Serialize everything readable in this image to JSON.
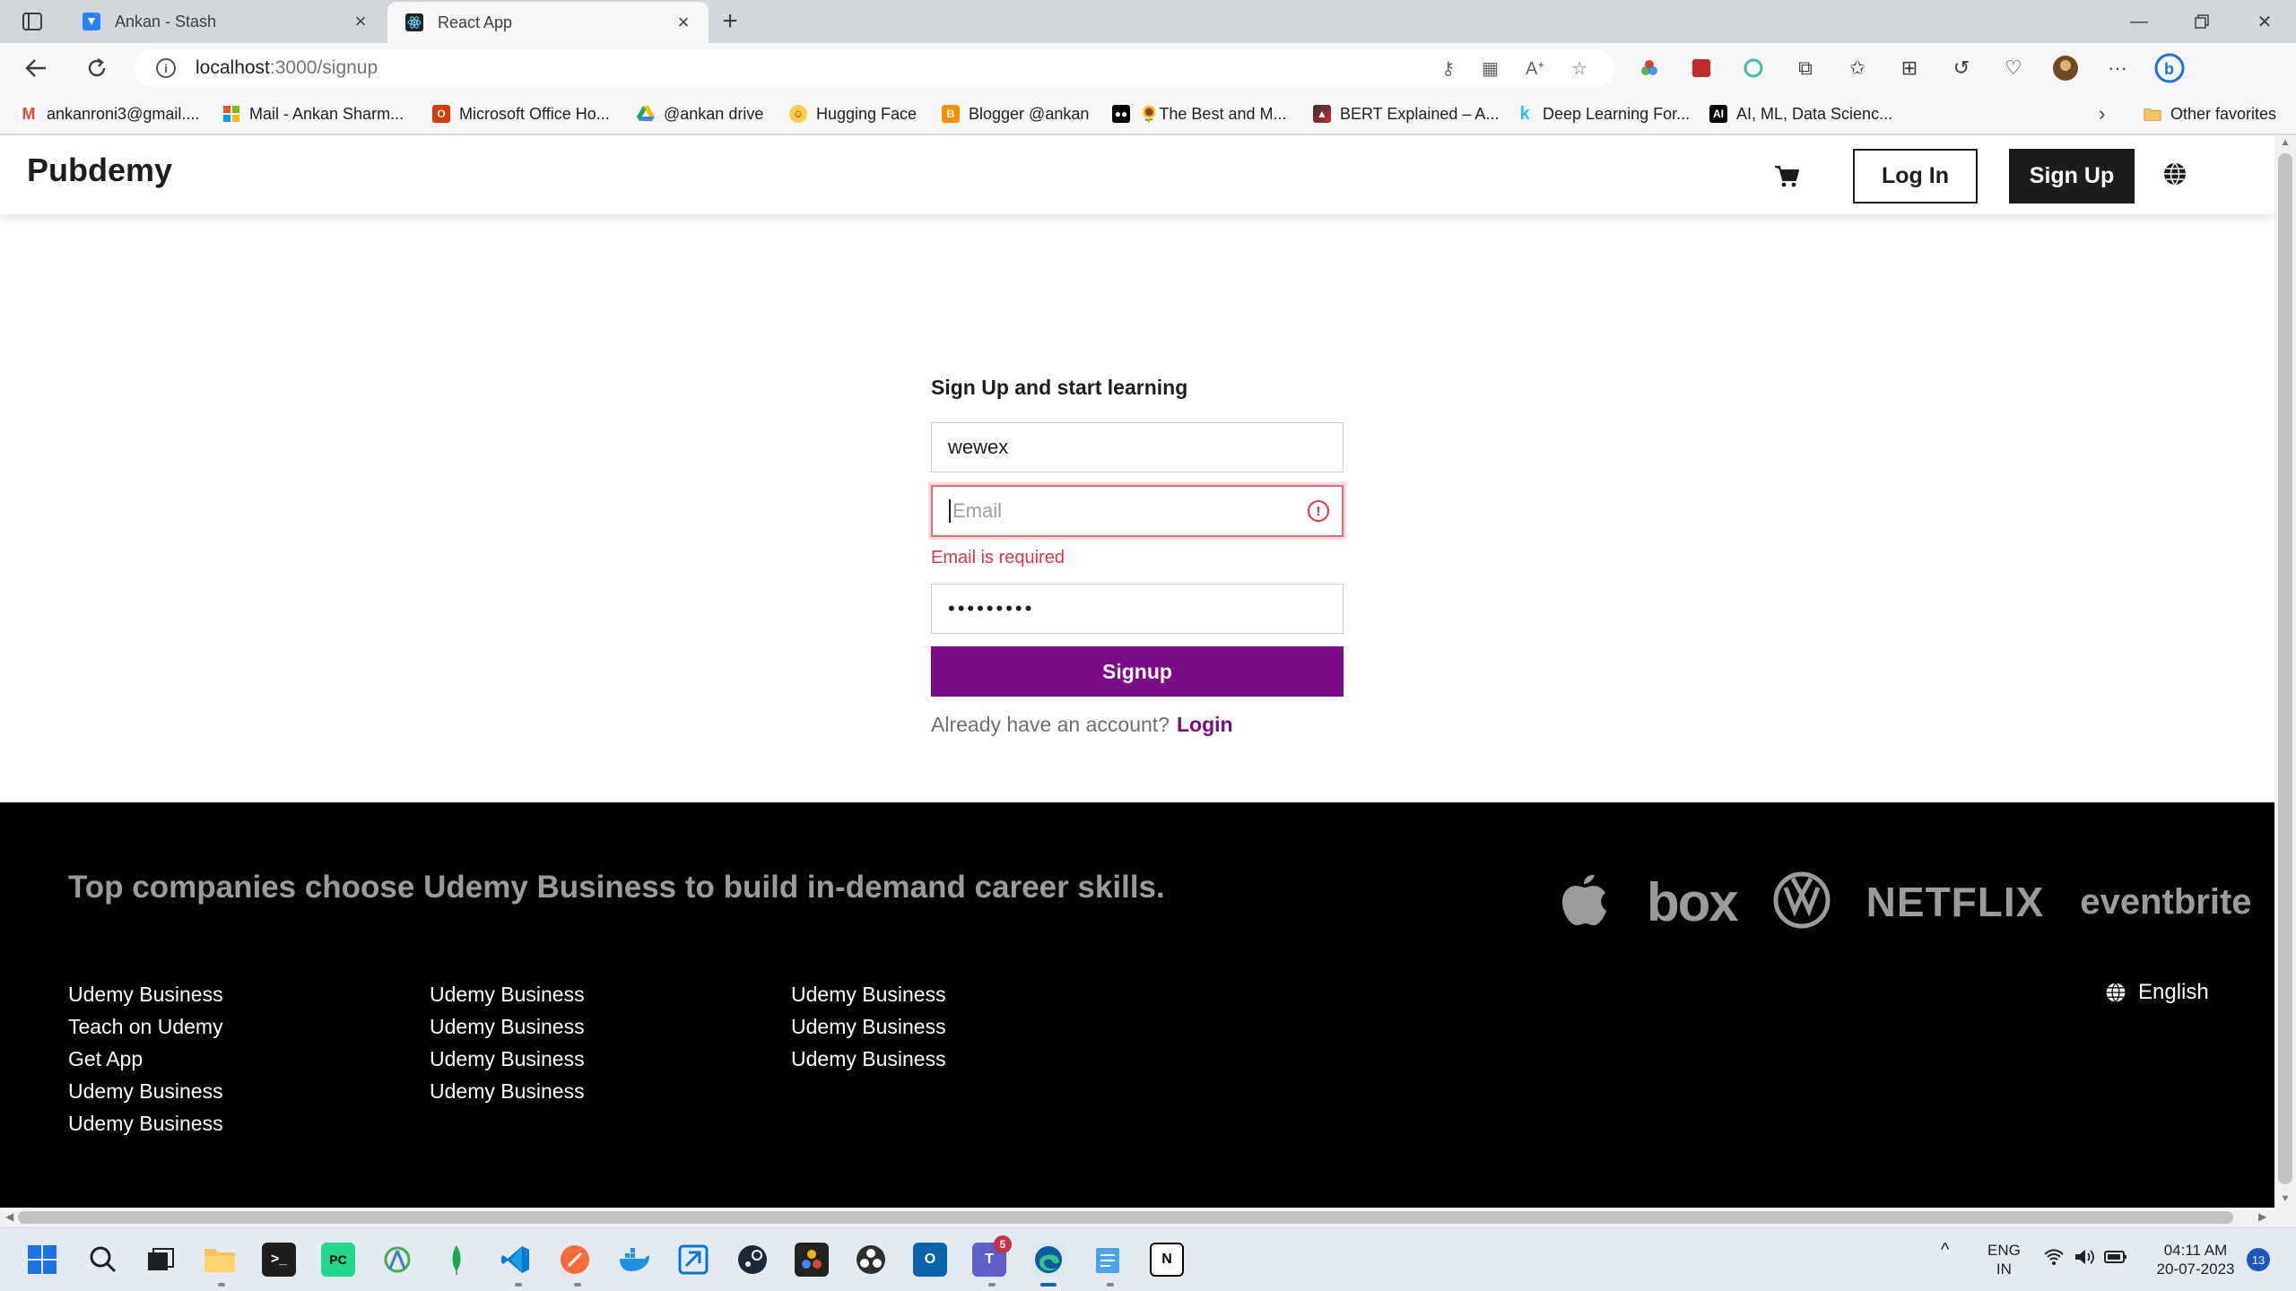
{
  "browser": {
    "tabs": [
      {
        "title": "Ankan - Stash",
        "active": false,
        "icon": "stash-icon"
      },
      {
        "title": "React App",
        "active": true,
        "icon": "react-icon"
      }
    ],
    "url": {
      "host": "localhost",
      "path": ":3000/signup"
    },
    "bookmarks": [
      {
        "label": "ankanroni3@gmail....",
        "icon": "gmail-icon",
        "color": "#ea4335"
      },
      {
        "label": "Mail - Ankan Sharm...",
        "icon": "microsoft-icon",
        "color": "#0078d4"
      },
      {
        "label": "Microsoft Office Ho...",
        "icon": "office-icon",
        "color": "#d83b01"
      },
      {
        "label": "@ankan drive",
        "icon": "drive-icon",
        "color": "#1fa463"
      },
      {
        "label": "Hugging Face",
        "icon": "hugging-face-icon",
        "color": "#ffcc4d"
      },
      {
        "label": "Blogger @ankan",
        "icon": "blogger-icon",
        "color": "#ff8f00"
      },
      {
        "label": "🌻The Best and M...",
        "icon": "medium-icon",
        "color": "#000000"
      },
      {
        "label": "BERT Explained – A...",
        "icon": "bert-icon",
        "color": "#333333"
      },
      {
        "label": "Deep Learning For...",
        "icon": "kaggle-icon",
        "color": "#20beff"
      },
      {
        "label": "AI, ML, Data Scienc...",
        "icon": "ai-icon",
        "color": "#000000"
      }
    ],
    "other_favorites": "Other favorites"
  },
  "site": {
    "logo": "Pubdemy",
    "login_label": "Log In",
    "signup_label": "Sign Up"
  },
  "form": {
    "title": "Sign Up and start learning",
    "name_value": "wewex",
    "email_placeholder": "Email",
    "email_error": "Email is required",
    "password_value": "•••••••••",
    "submit_label": "Signup",
    "have_account_text": "Already have an account?",
    "login_link": "Login"
  },
  "footer": {
    "heading": "Top companies choose Udemy Business to build in-demand career skills.",
    "company_logos": [
      "apple-logo",
      "box",
      "volkswagen-logo",
      "NETFLIX",
      "eventbrite"
    ],
    "col1": [
      "Udemy Business",
      "Teach on Udemy",
      "Get App",
      "Udemy Business",
      "Udemy Business"
    ],
    "col2": [
      "Udemy Business",
      "Udemy Business",
      "Udemy Business",
      "Udemy Business"
    ],
    "col3": [
      "Udemy Business",
      "Udemy Business",
      "Udemy Business"
    ],
    "language": "English"
  },
  "taskbar": {
    "lang_top": "ENG",
    "lang_bottom": "IN",
    "time": "04:11 AM",
    "date": "20-07-2023",
    "notification_count": "13",
    "teams_badge": "5"
  },
  "colors": {
    "primary": "#7a0a86",
    "error": "#d93848",
    "footer_bg": "#000000"
  }
}
